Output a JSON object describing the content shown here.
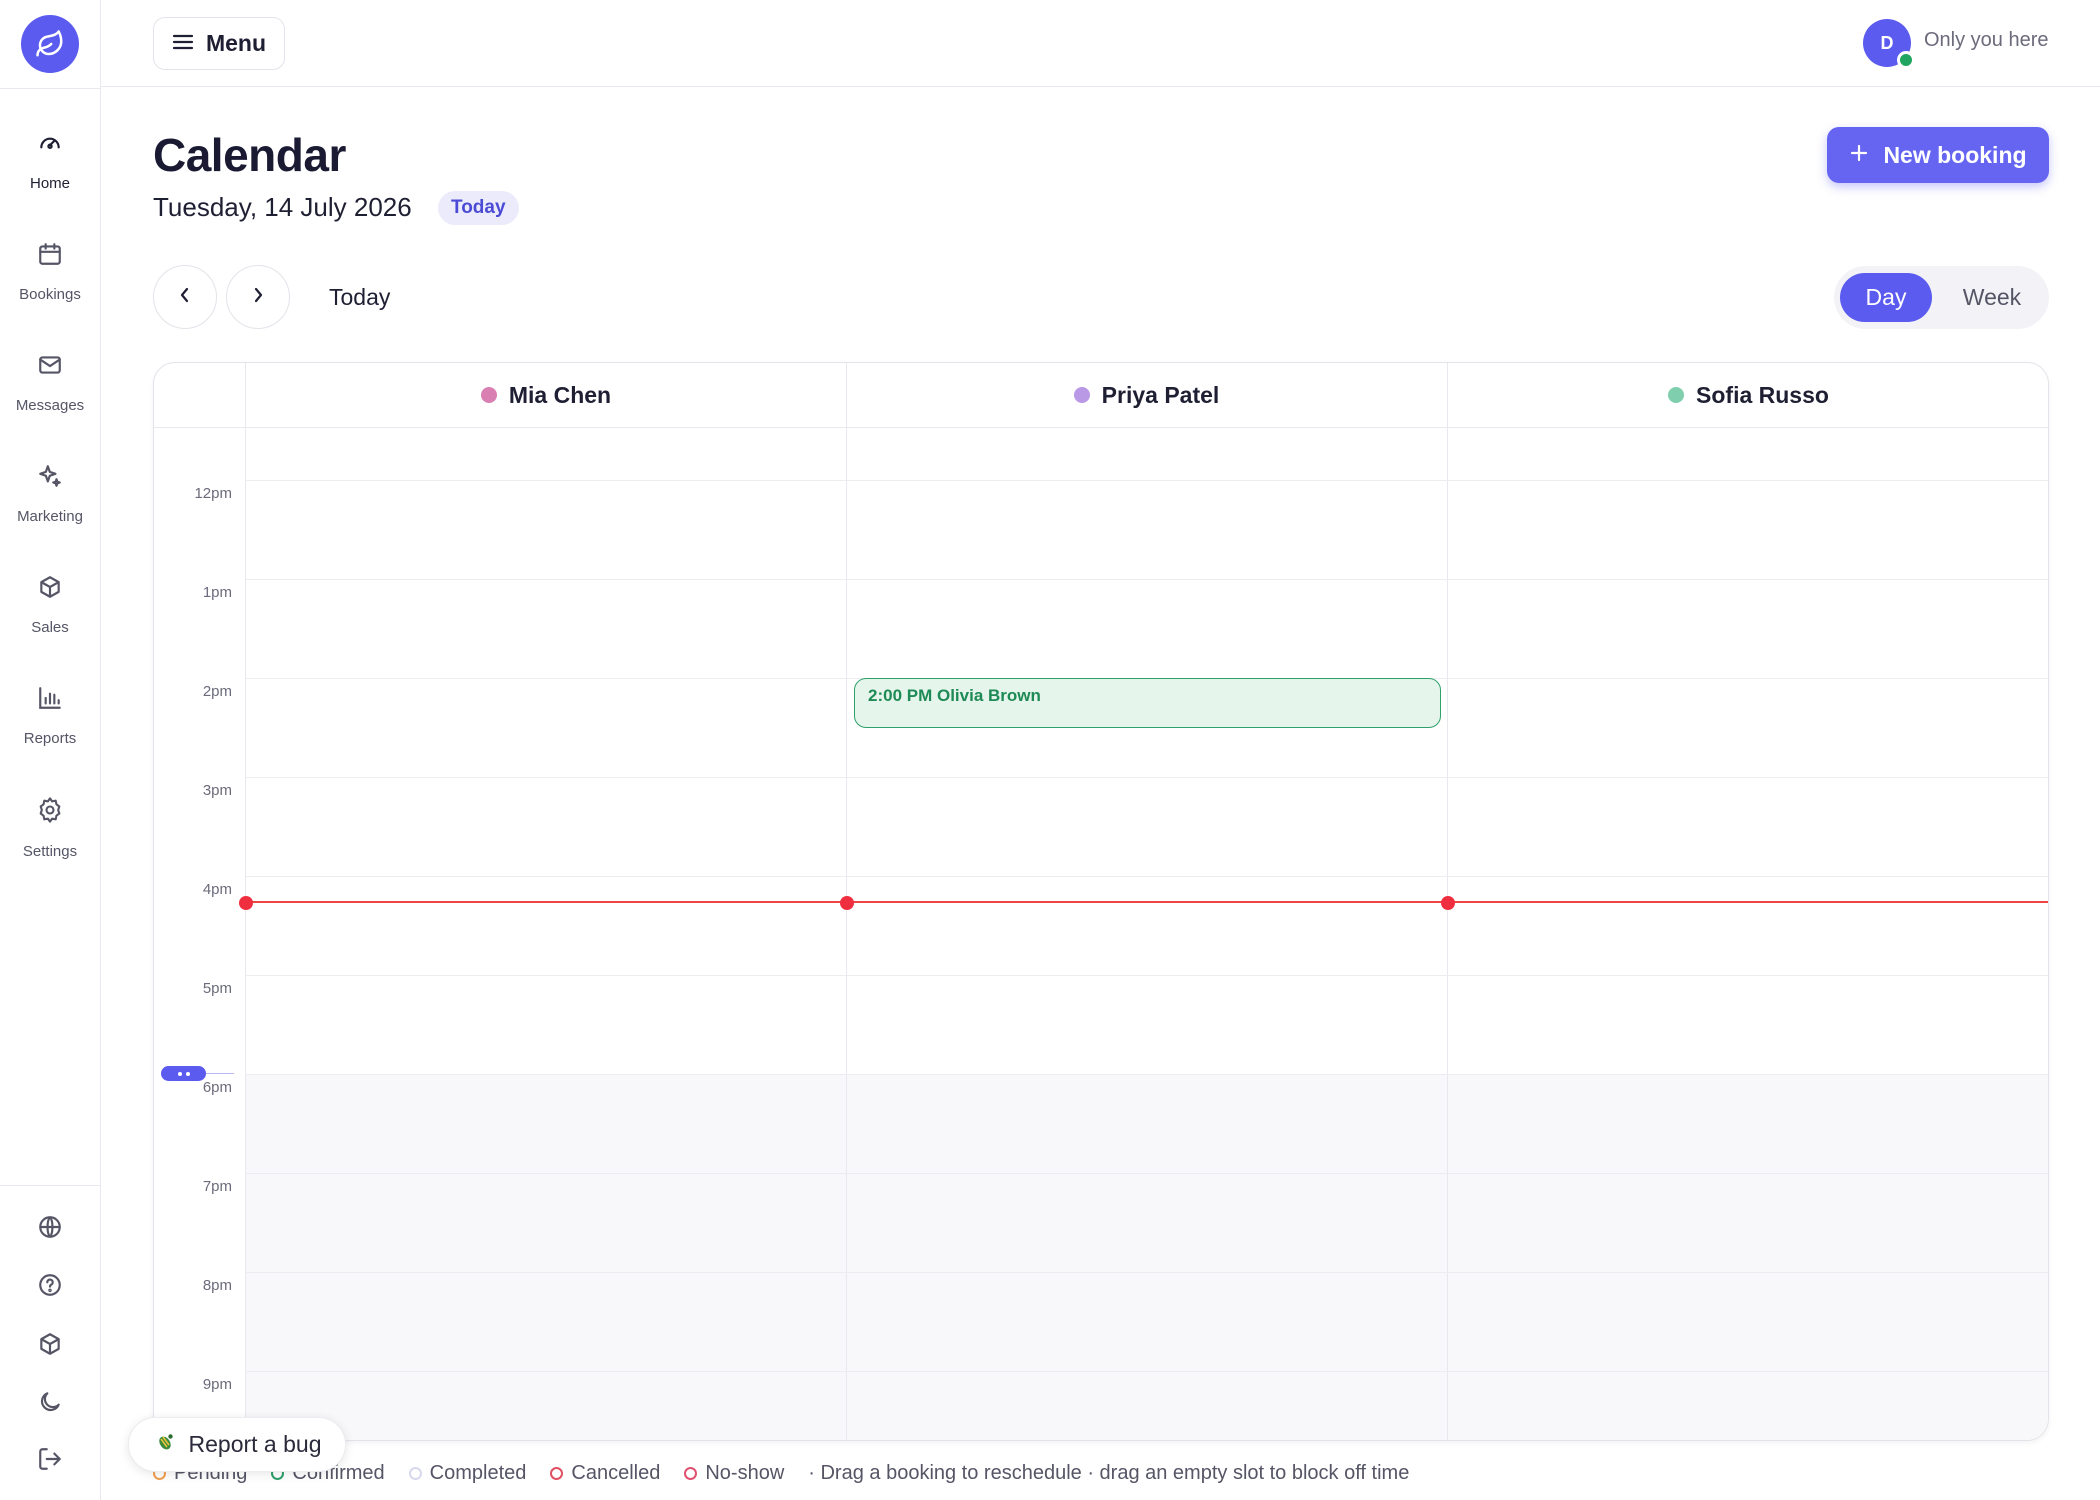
{
  "sidebar": {
    "items": [
      {
        "label": "Home",
        "icon": "gauge-icon",
        "active": true
      },
      {
        "label": "Bookings",
        "icon": "calendar-icon"
      },
      {
        "label": "Messages",
        "icon": "mail-icon"
      },
      {
        "label": "Marketing",
        "icon": "sparkle-icon"
      },
      {
        "label": "Sales",
        "icon": "box-icon"
      },
      {
        "label": "Reports",
        "icon": "bar-chart-icon"
      },
      {
        "label": "Settings",
        "icon": "gear-icon"
      }
    ],
    "utility_icons": [
      "globe-icon",
      "help-icon",
      "box-icon",
      "moon-icon",
      "logout-icon"
    ]
  },
  "topbar": {
    "menu_label": "Menu",
    "avatar_initial": "D",
    "presence_text": "Only you here"
  },
  "header": {
    "title": "Calendar",
    "date": "Tuesday, 14 July 2026",
    "today_badge": "Today",
    "new_booking_label": "New booking"
  },
  "controls": {
    "today_label": "Today",
    "views": [
      "Day",
      "Week"
    ],
    "selected_view": "Day"
  },
  "calendar": {
    "staff": [
      {
        "name": "Mia Chen",
        "color": "#d97fb2"
      },
      {
        "name": "Priya Patel",
        "color": "#b998e6"
      },
      {
        "name": "Sofia Russo",
        "color": "#7fcfae"
      }
    ],
    "hours": [
      "12pm",
      "1pm",
      "2pm",
      "3pm",
      "4pm",
      "5pm",
      "6pm",
      "7pm",
      "8pm",
      "9pm"
    ],
    "bookings": [
      {
        "staff": "Priya Patel",
        "time": "2:00 PM",
        "client": "Olivia Brown",
        "label": "2:00 PM Olivia Brown",
        "status": "Confirmed"
      }
    ]
  },
  "legend": {
    "statuses": [
      {
        "label": "Pending",
        "color": "#f0a050"
      },
      {
        "label": "Confirmed",
        "color": "#2ea06a"
      },
      {
        "label": "Completed",
        "color": "#d8d8ee"
      },
      {
        "label": "Cancelled",
        "color": "#e05060"
      },
      {
        "label": "No-show",
        "color": "#e05070"
      }
    ],
    "hint": "· Drag a booking to reschedule · drag an empty slot to block off time"
  },
  "report_bug_label": "Report a bug"
}
